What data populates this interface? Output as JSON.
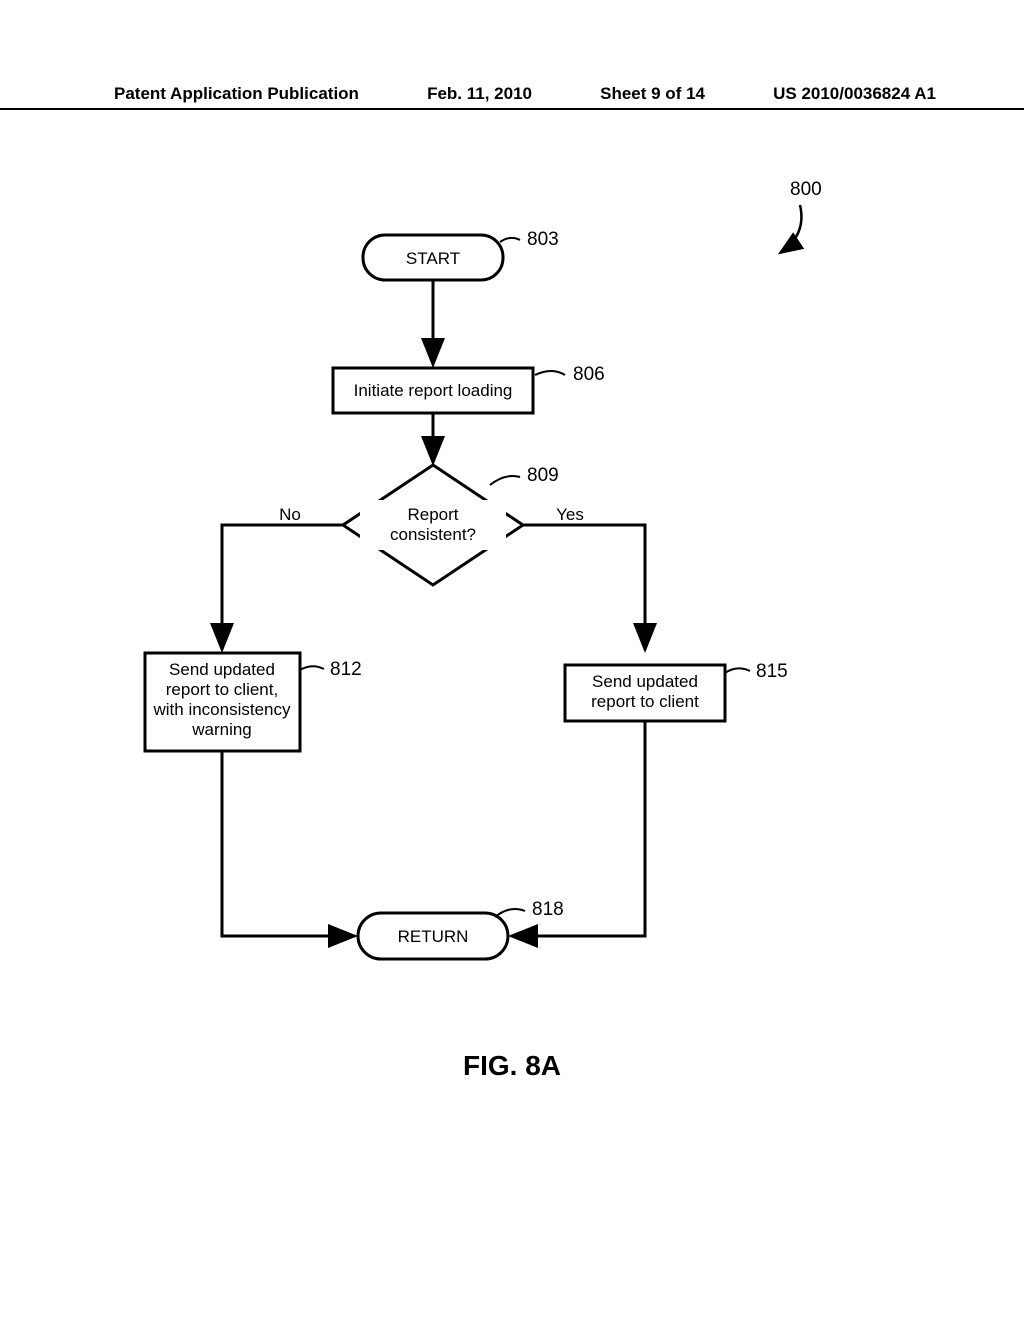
{
  "header": {
    "pub_type": "Patent Application Publication",
    "date": "Feb. 11, 2010",
    "sheet": "Sheet 9 of 14",
    "pub_number": "US 2010/0036824 A1"
  },
  "figure_label": "FIG. 8A",
  "nodes": {
    "start": "START",
    "initiate": "Initiate report loading",
    "decision": "Report consistent?",
    "no_branch": "Send updated report to client, with inconsistency warning",
    "yes_branch": "Send updated report to client",
    "return": "RETURN"
  },
  "labels": {
    "no": "No",
    "yes": "Yes"
  },
  "refs": {
    "overall": "800",
    "start": "803",
    "initiate": "806",
    "decision": "809",
    "no_branch": "812",
    "yes_branch": "815",
    "return": "818"
  }
}
